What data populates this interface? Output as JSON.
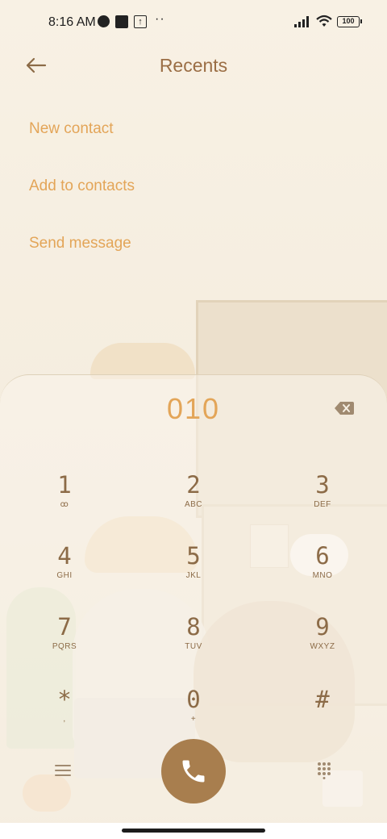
{
  "status_bar": {
    "time": "8:16 AM",
    "battery": "100",
    "dots": "··",
    "icons": [
      "notification-circle-icon",
      "app-square-icon",
      "upload-icon",
      "signal-icon",
      "wifi-icon",
      "battery-icon"
    ]
  },
  "header": {
    "title": "Recents",
    "back_icon": "back-arrow-icon"
  },
  "menu": {
    "new_contact": "New contact",
    "add_to_contacts": "Add to contacts",
    "send_message": "Send message"
  },
  "dialer": {
    "number": "010",
    "keys": [
      {
        "digit": "1",
        "letters": "ꝏ"
      },
      {
        "digit": "2",
        "letters": "ABC"
      },
      {
        "digit": "3",
        "letters": "DEF"
      },
      {
        "digit": "4",
        "letters": "GHI"
      },
      {
        "digit": "5",
        "letters": "JKL"
      },
      {
        "digit": "6",
        "letters": "MNO"
      },
      {
        "digit": "7",
        "letters": "PQRS"
      },
      {
        "digit": "8",
        "letters": "TUV"
      },
      {
        "digit": "9",
        "letters": "WXYZ"
      },
      {
        "digit": "*",
        "letters": ","
      },
      {
        "digit": "0",
        "letters": "+"
      },
      {
        "digit": "#",
        "letters": ""
      }
    ]
  },
  "colors": {
    "accent": "#e3a558",
    "title": "#9b6e45",
    "key_text": "#8c6b47",
    "call_button": "#a87e4e"
  }
}
